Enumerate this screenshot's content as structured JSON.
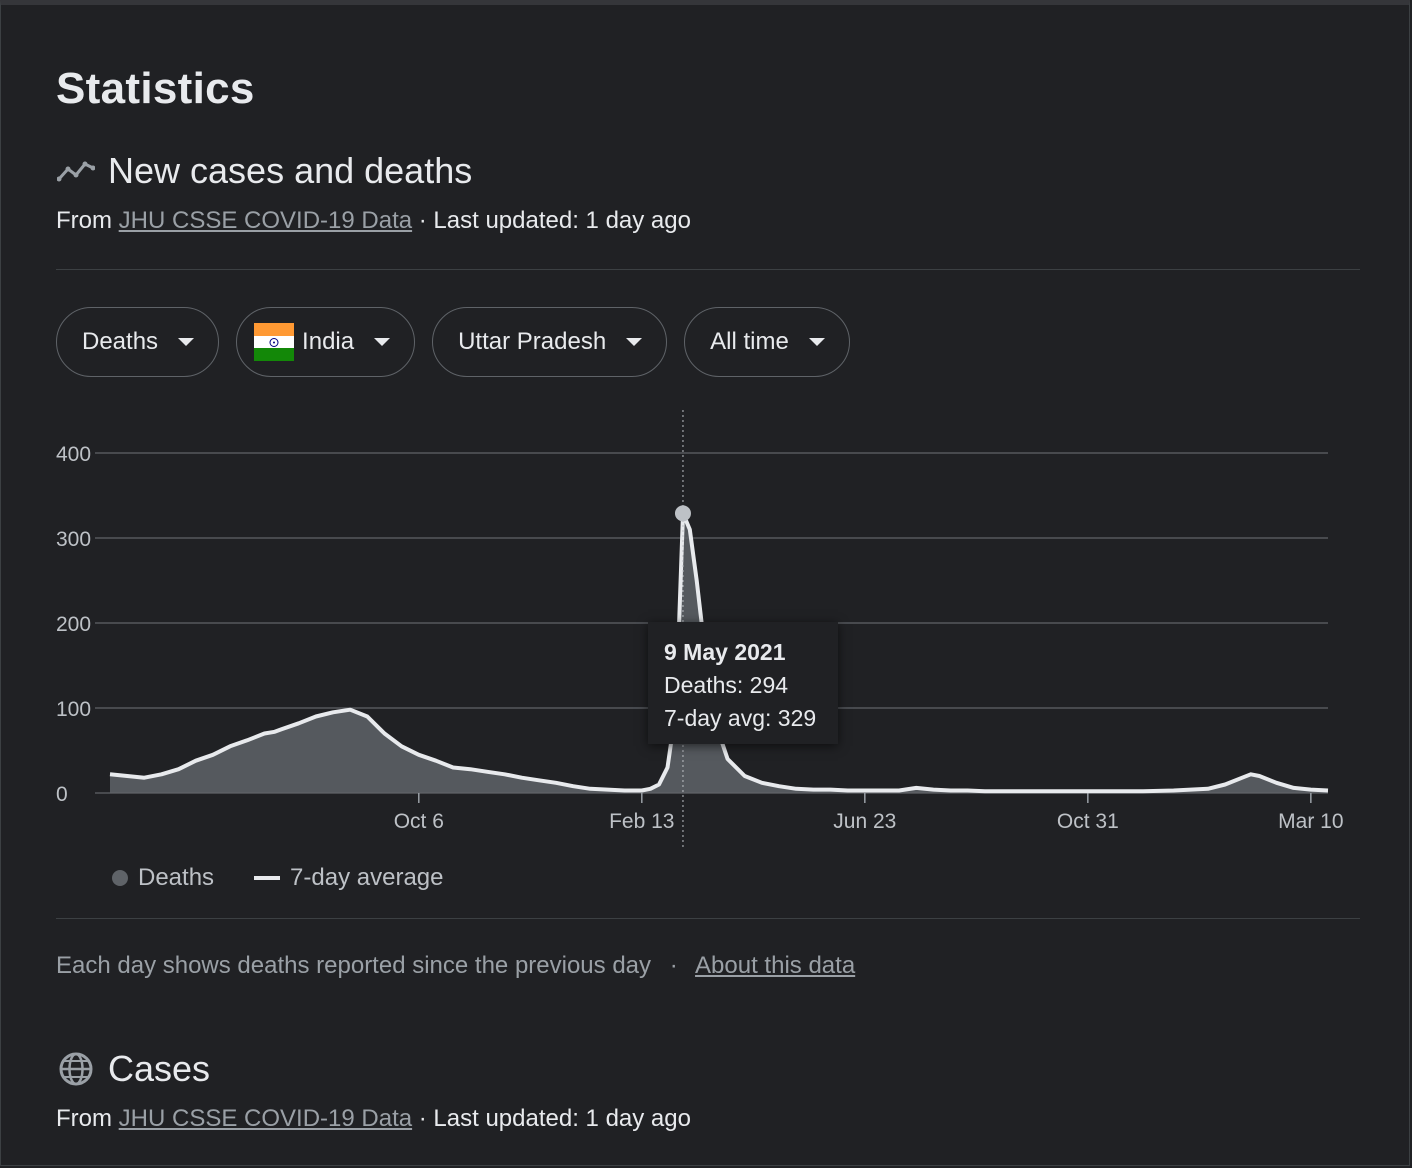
{
  "page": {
    "title": "Statistics"
  },
  "section_cases_deaths": {
    "heading": "New cases and deaths",
    "from": "From",
    "source_link": "JHU CSSE COVID-19 Data",
    "updated": "· Last updated: 1 day ago"
  },
  "filters": {
    "metric": "Deaths",
    "country": "India",
    "region": "Uttar Pradesh",
    "range": "All time"
  },
  "colors": {
    "bars": "#5f6368",
    "area": "#5f6368",
    "avg_line": "#e8eaed",
    "flag_saffron": "#ff9933",
    "flag_white": "#ffffff",
    "flag_green": "#138808"
  },
  "tooltip": {
    "date": "9 May 2021",
    "deaths": "Deaths: 294",
    "avg": "7-day avg: 329"
  },
  "legend": {
    "deaths": "Deaths",
    "avg": "7-day average"
  },
  "footer": {
    "note": "Each day shows deaths reported since the previous day",
    "sep": "·",
    "about_link": "About this data"
  },
  "section_cases": {
    "heading": "Cases",
    "from": "From",
    "source_link": "JHU CSSE COVID-19 Data",
    "updated": "· Last updated: 1 day ago"
  },
  "chart_data": {
    "type": "area",
    "y_ticks": [
      0,
      100,
      200,
      300,
      400
    ],
    "ylim": [
      0,
      450
    ],
    "x_ticks": [
      "Oct 6",
      "Feb 13",
      "Jun 23",
      "Oct 31",
      "Mar 10"
    ],
    "x_tick_days": [
      180,
      310,
      440,
      570,
      700
    ],
    "x_range_days": [
      0,
      710
    ],
    "highlight_day": 334,
    "highlight_value": 329,
    "grid": true,
    "series": [
      {
        "name": "7-day average",
        "days": [
          0,
          10,
          20,
          30,
          40,
          50,
          60,
          70,
          80,
          90,
          96,
          100,
          110,
          120,
          130,
          140,
          150,
          160,
          170,
          180,
          190,
          200,
          210,
          220,
          230,
          240,
          250,
          260,
          270,
          280,
          290,
          300,
          310,
          315,
          320,
          325,
          330,
          334,
          338,
          342,
          346,
          350,
          355,
          360,
          370,
          380,
          390,
          400,
          410,
          420,
          430,
          440,
          450,
          460,
          470,
          480,
          490,
          500,
          510,
          520,
          540,
          560,
          580,
          600,
          620,
          640,
          650,
          660,
          665,
          670,
          680,
          690,
          700,
          710
        ],
        "values": [
          22,
          20,
          18,
          22,
          28,
          38,
          45,
          55,
          62,
          70,
          72,
          75,
          82,
          90,
          95,
          98,
          90,
          70,
          55,
          45,
          38,
          30,
          28,
          25,
          22,
          18,
          15,
          12,
          8,
          5,
          4,
          3,
          3,
          5,
          10,
          30,
          100,
          329,
          310,
          250,
          180,
          120,
          70,
          40,
          20,
          12,
          8,
          5,
          4,
          4,
          3,
          3,
          3,
          3,
          6,
          4,
          3,
          3,
          2,
          2,
          2,
          2,
          2,
          2,
          3,
          5,
          10,
          18,
          22,
          20,
          12,
          6,
          4,
          3
        ]
      }
    ]
  }
}
